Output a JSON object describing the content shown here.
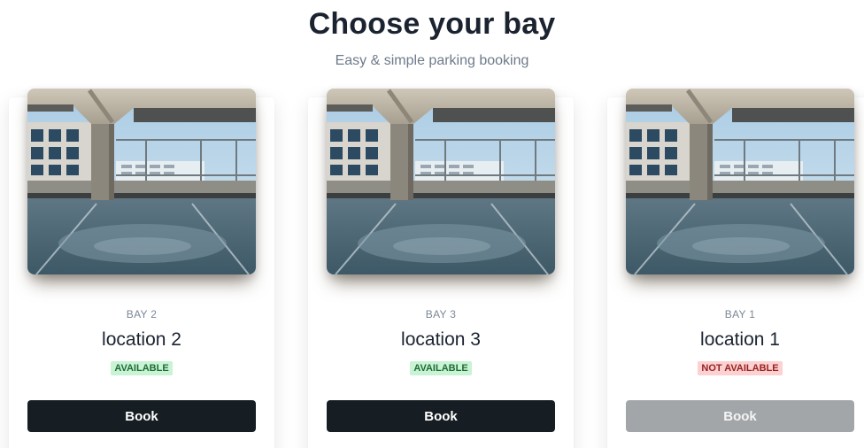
{
  "header": {
    "title": "Choose your bay",
    "subtitle": "Easy & simple parking booking"
  },
  "cards": [
    {
      "bay": "BAY 2",
      "location": "location 2",
      "status": "AVAILABLE",
      "available": true,
      "button": "Book"
    },
    {
      "bay": "BAY 3",
      "location": "location 3",
      "status": "AVAILABLE",
      "available": true,
      "button": "Book"
    },
    {
      "bay": "BAY 1",
      "location": "location 1",
      "status": "NOT AVAILABLE",
      "available": false,
      "button": "Book"
    }
  ],
  "colors": {
    "title": "#1b2331",
    "button_active": "#161e23",
    "button_disabled": "#a3a6a8",
    "badge_available_bg": "#c8f3d4",
    "badge_unavailable_bg": "#fbd1d1"
  }
}
